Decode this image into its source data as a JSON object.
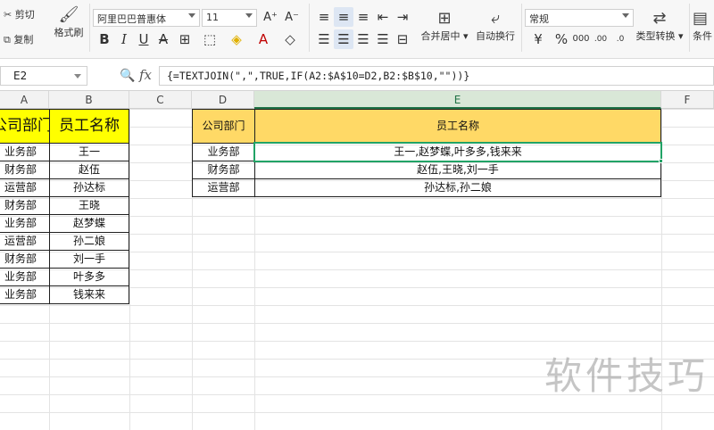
{
  "ribbon": {
    "cut": "剪切",
    "copy": "复制",
    "format_painter": "格式刷",
    "font_name": "阿里巴巴普惠体",
    "font_size": "11",
    "merge_center": "合并居中",
    "wrap_text": "自动换行",
    "number_format": "常规",
    "convert_type": "类型转换",
    "conditional": "条件"
  },
  "formula_bar": {
    "name_box": "E2",
    "fx": "fx",
    "formula": "{=TEXTJOIN(\",\",TRUE,IF(A2:$A$10=D2,B2:$B$10,\"\"))}"
  },
  "columns": [
    "A",
    "B",
    "C",
    "D",
    "E",
    "F"
  ],
  "left_table": {
    "headers": [
      "公司部门",
      "员工名称"
    ],
    "rows": [
      [
        "业务部",
        "王一"
      ],
      [
        "财务部",
        "赵伍"
      ],
      [
        "运营部",
        "孙达标"
      ],
      [
        "财务部",
        "王晓"
      ],
      [
        "业务部",
        "赵梦蝶"
      ],
      [
        "运营部",
        "孙二娘"
      ],
      [
        "财务部",
        "刘一手"
      ],
      [
        "业务部",
        "叶多多"
      ],
      [
        "业务部",
        "钱来来"
      ]
    ]
  },
  "right_table": {
    "headers": [
      "公司部门",
      "员工名称"
    ],
    "rows": [
      [
        "业务部",
        "王一,赵梦蝶,叶多多,钱来来"
      ],
      [
        "财务部",
        "赵伍,王晓,刘一手"
      ],
      [
        "运营部",
        "孙达标,孙二娘"
      ]
    ]
  },
  "watermark": "软件技巧"
}
